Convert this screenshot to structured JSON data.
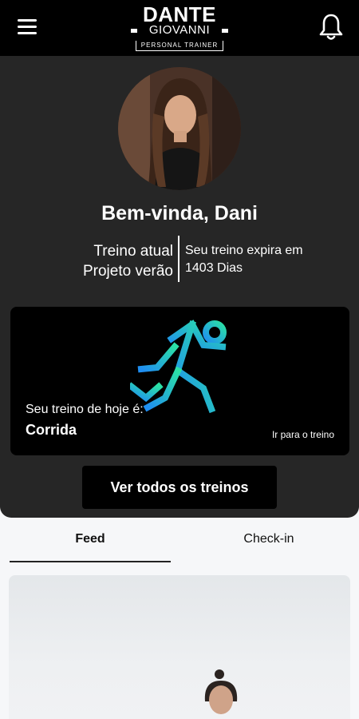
{
  "header": {
    "logo": {
      "line1": "DANTE",
      "line2": "GIOVANNI",
      "line3": "PERSONAL TRAINER"
    },
    "menu_icon": "hamburger-menu-icon",
    "notification_icon": "bell-icon"
  },
  "profile": {
    "welcome": "Bem-vinda, Dani",
    "current_workout_label": "Treino atual",
    "current_workout_name": "Projeto verão",
    "expiry_label": "Seu treino expira em",
    "expiry_value": "1403 Dias"
  },
  "today": {
    "label": "Seu treino de hoje é:",
    "value": "Corrida",
    "link": "Ir para o treino",
    "icon": "running-person-icon"
  },
  "buttons": {
    "all_workouts": "Ver todos os treinos"
  },
  "tabs": [
    {
      "label": "Feed",
      "active": true
    },
    {
      "label": "Check-in",
      "active": false
    }
  ],
  "colors": {
    "header_bg": "#000000",
    "panel_bg": "#262626",
    "runner_gradient_start": "#2be1a6",
    "runner_gradient_end": "#1f8ef1"
  }
}
